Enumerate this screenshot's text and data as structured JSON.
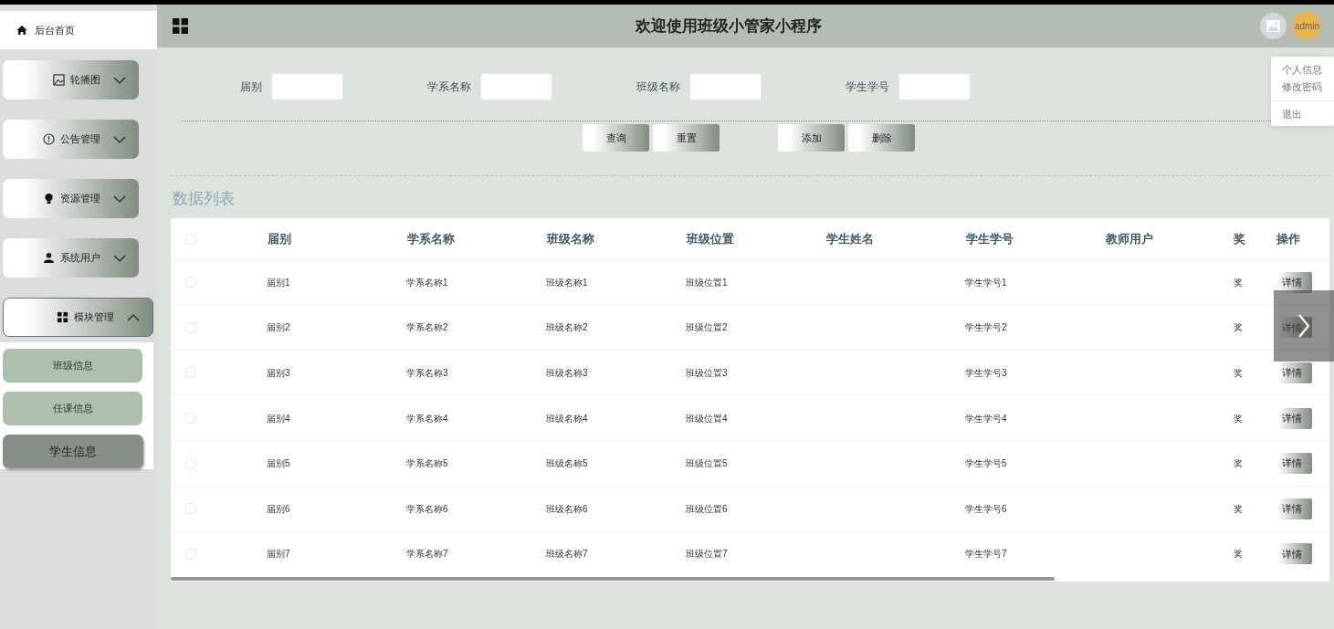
{
  "header": {
    "title": "欢迎使用班级小管家小程序",
    "user": "admin"
  },
  "user_menu": {
    "items": [
      "个人信息",
      "修改密码",
      "退出"
    ]
  },
  "sidebar": {
    "home": "后台首页",
    "menus": [
      {
        "label": "轮播图",
        "expanded": false
      },
      {
        "label": "公告管理",
        "expanded": false
      },
      {
        "label": "资源管理",
        "expanded": false
      },
      {
        "label": "系统用户",
        "expanded": false
      },
      {
        "label": "模块管理",
        "expanded": true,
        "children": [
          {
            "label": "班级信息",
            "selected": false
          },
          {
            "label": "任课信息",
            "selected": false
          },
          {
            "label": "学生信息",
            "selected": true
          }
        ]
      }
    ]
  },
  "search": {
    "fields": [
      {
        "label": "届别"
      },
      {
        "label": "学系名称"
      },
      {
        "label": "班级名称"
      },
      {
        "label": "学生学号"
      }
    ],
    "query_buttons": [
      "查询",
      "重置"
    ],
    "edit_buttons": [
      "添加",
      "删除"
    ]
  },
  "section_title": "数据列表",
  "table": {
    "select_all": {
      "checked": false
    },
    "columns": [
      "届别",
      "学系名称",
      "班级名称",
      "班级位置",
      "学生姓名",
      "学生学号",
      "教师用户",
      "奖",
      "操作"
    ],
    "rows": [
      {
        "checked": false,
        "cells": [
          "届别1",
          "学系名称1",
          "班级名称1",
          "班级位置1",
          null,
          "学生学号1",
          null,
          "奖"
        ],
        "action": "详情"
      },
      {
        "checked": false,
        "cells": [
          "届别2",
          "学系名称2",
          "班级名称2",
          "班级位置2",
          null,
          "学生学号2",
          null,
          "奖"
        ],
        "action": "详情"
      },
      {
        "checked": false,
        "cells": [
          "届别3",
          "学系名称3",
          "班级名称3",
          "班级位置3",
          null,
          "学生学号3",
          null,
          "奖"
        ],
        "action": "详情"
      },
      {
        "checked": false,
        "cells": [
          "届别4",
          "学系名称4",
          "班级名称4",
          "班级位置4",
          null,
          "学生学号4",
          null,
          "奖"
        ],
        "action": "详情"
      },
      {
        "checked": false,
        "cells": [
          "届别5",
          "学系名称5",
          "班级名称5",
          "班级位置5",
          null,
          "学生学号5",
          null,
          "奖"
        ],
        "action": "详情"
      },
      {
        "checked": false,
        "cells": [
          "届别6",
          "学系名称6",
          "班级名称6",
          "班级位置6",
          null,
          "学生学号6",
          null,
          "奖"
        ],
        "action": "详情"
      },
      {
        "checked": false,
        "cells": [
          "届别7",
          "学系名称7",
          "班级名称7",
          "班级位置7",
          null,
          "学生学号7",
          null,
          "奖"
        ],
        "action": "详情"
      }
    ]
  }
}
